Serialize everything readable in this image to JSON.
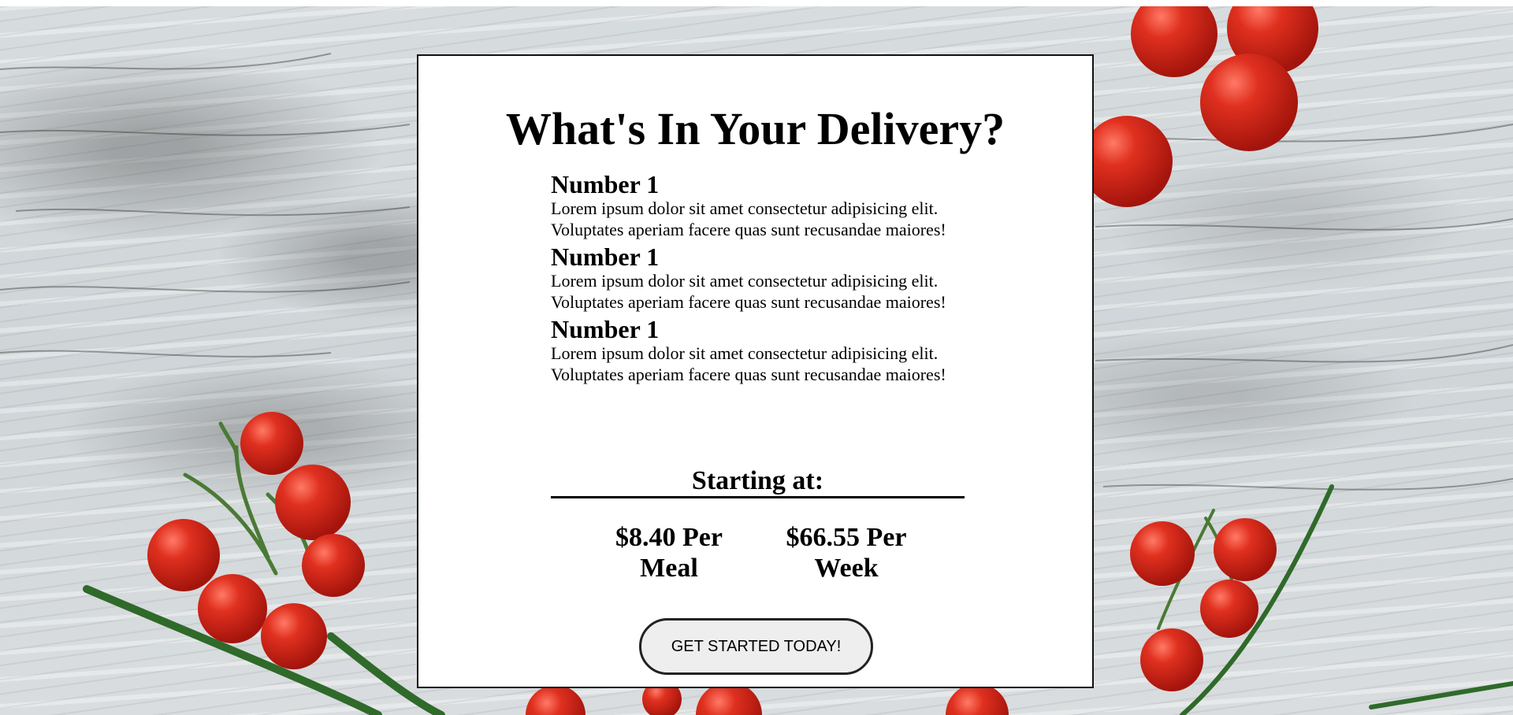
{
  "card": {
    "title": "What's In Your Delivery?",
    "items": [
      {
        "heading": "Number 1",
        "body": "Lorem ipsum dolor sit amet consectetur adipisicing elit. Voluptates aperiam facere quas sunt recusandae maiores!"
      },
      {
        "heading": "Number 1",
        "body": "Lorem ipsum dolor sit amet consectetur adipisicing elit. Voluptates aperiam facere quas sunt recusandae maiores!"
      },
      {
        "heading": "Number 1",
        "body": "Lorem ipsum dolor sit amet consectetur adipisicing elit. Voluptates aperiam facere quas sunt recusandae maiores!"
      }
    ],
    "starting_label": "Starting at:",
    "prices": {
      "per_meal": "$8.40 Per Meal",
      "per_week": "$66.55 Per Week"
    },
    "cta_label": "GET STARTED TODAY!"
  },
  "colors": {
    "tomato": "#d8261c",
    "stem": "#3f6b2e",
    "wood": "#d3d8da",
    "card_border": "#111111",
    "button_bg": "#eeeeee"
  }
}
